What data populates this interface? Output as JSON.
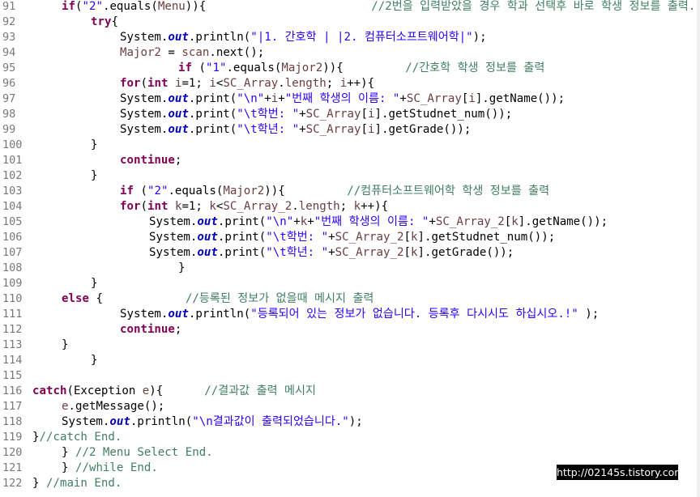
{
  "colors": {
    "background": "#ffffff",
    "line_number": "#787878",
    "keyword": "#7f0055",
    "string": "#2a00ff",
    "static_field": "#0000c0",
    "local_variable": "#6a3e3e",
    "comment": "#3f7f5f",
    "default_text": "#000000"
  },
  "lines": [
    {
      "n": "91",
      "indent": 1,
      "tokens": [
        [
          "kw",
          "if"
        ],
        [
          "t",
          "("
        ],
        [
          "str",
          "\"2\""
        ],
        [
          "t",
          ".equals("
        ],
        [
          "var",
          "Menu"
        ],
        [
          "t",
          "))"
        ],
        [
          "t",
          "{"
        ],
        [
          "sp",
          24
        ],
        [
          "cmt",
          "//2번을 입력받았을 경우 학과 선택후 바로 학생 정보를 출력."
        ]
      ]
    },
    {
      "n": "92",
      "indent": 2,
      "tokens": [
        [
          "kw",
          "try"
        ],
        [
          "t",
          "{"
        ]
      ]
    },
    {
      "n": "93",
      "indent": 3,
      "tokens": [
        [
          "t",
          "System."
        ],
        [
          "fld",
          "out"
        ],
        [
          "t",
          ".println("
        ],
        [
          "str",
          "\"|1. 간호학 | |2. 컴퓨터소프트웨어학|\""
        ],
        [
          "t",
          ");"
        ]
      ]
    },
    {
      "n": "94",
      "indent": 3,
      "tokens": [
        [
          "var",
          "Major2"
        ],
        [
          "t",
          " = "
        ],
        [
          "var",
          "scan"
        ],
        [
          "t",
          ".next();"
        ]
      ]
    },
    {
      "n": "95",
      "indent": 5,
      "tokens": [
        [
          "kw",
          "if"
        ],
        [
          "t",
          " ("
        ],
        [
          "str",
          "\"1\""
        ],
        [
          "t",
          ".equals("
        ],
        [
          "var",
          "Major2"
        ],
        [
          "t",
          "))"
        ],
        [
          "t",
          "{"
        ],
        [
          "sp",
          9
        ],
        [
          "cmt",
          "//간호학 학생 정보를 출력"
        ]
      ]
    },
    {
      "n": "96",
      "indent": 3,
      "tokens": [
        [
          "kw",
          "for"
        ],
        [
          "t",
          "("
        ],
        [
          "kw",
          "int"
        ],
        [
          "t",
          " "
        ],
        [
          "var",
          "i"
        ],
        [
          "t",
          "=1; "
        ],
        [
          "var",
          "i"
        ],
        [
          "t",
          "<"
        ],
        [
          "var",
          "SC_Array"
        ],
        [
          "t",
          "."
        ],
        [
          "var",
          "length"
        ],
        [
          "t",
          "; "
        ],
        [
          "var",
          "i"
        ],
        [
          "t",
          "++){"
        ]
      ]
    },
    {
      "n": "97",
      "indent": 3,
      "tokens": [
        [
          "t",
          "System."
        ],
        [
          "fld",
          "out"
        ],
        [
          "t",
          ".print("
        ],
        [
          "str",
          "\"\\n\""
        ],
        [
          "t",
          "+"
        ],
        [
          "var",
          "i"
        ],
        [
          "t",
          "+"
        ],
        [
          "str",
          "\"번째 학생의 이름: \""
        ],
        [
          "t",
          "+"
        ],
        [
          "var",
          "SC_Array"
        ],
        [
          "t",
          "["
        ],
        [
          "var",
          "i"
        ],
        [
          "t",
          "].getName());"
        ]
      ]
    },
    {
      "n": "98",
      "indent": 3,
      "tokens": [
        [
          "t",
          "System."
        ],
        [
          "fld",
          "out"
        ],
        [
          "t",
          ".print("
        ],
        [
          "str",
          "\"\\t학번: \""
        ],
        [
          "t",
          "+"
        ],
        [
          "var",
          "SC_Array"
        ],
        [
          "t",
          "["
        ],
        [
          "var",
          "i"
        ],
        [
          "t",
          "].getStudnet_num());"
        ]
      ]
    },
    {
      "n": "99",
      "indent": 3,
      "tokens": [
        [
          "t",
          "System."
        ],
        [
          "fld",
          "out"
        ],
        [
          "t",
          ".print("
        ],
        [
          "str",
          "\"\\t학년: \""
        ],
        [
          "t",
          "+"
        ],
        [
          "var",
          "SC_Array"
        ],
        [
          "t",
          "["
        ],
        [
          "var",
          "i"
        ],
        [
          "t",
          "].getGrade());"
        ]
      ]
    },
    {
      "n": "100",
      "indent": 2,
      "tokens": [
        [
          "t",
          "}"
        ]
      ]
    },
    {
      "n": "101",
      "indent": 3,
      "tokens": [
        [
          "kw",
          "continue"
        ],
        [
          "t",
          ";"
        ]
      ]
    },
    {
      "n": "102",
      "indent": 2,
      "tokens": [
        [
          "t",
          "}"
        ]
      ]
    },
    {
      "n": "103",
      "indent": 3,
      "tokens": [
        [
          "kw",
          "if"
        ],
        [
          "t",
          " ("
        ],
        [
          "str",
          "\"2\""
        ],
        [
          "t",
          ".equals("
        ],
        [
          "var",
          "Major2"
        ],
        [
          "t",
          "))"
        ],
        [
          "t",
          "{"
        ],
        [
          "sp",
          9
        ],
        [
          "cmt",
          "//컴퓨터소프트웨어학 학생 정보를 출력"
        ]
      ]
    },
    {
      "n": "104",
      "indent": 3,
      "tokens": [
        [
          "kw",
          "for"
        ],
        [
          "t",
          "("
        ],
        [
          "kw",
          "int"
        ],
        [
          "t",
          " "
        ],
        [
          "var",
          "k"
        ],
        [
          "t",
          "=1; "
        ],
        [
          "var",
          "k"
        ],
        [
          "t",
          "<"
        ],
        [
          "var",
          "SC_Array_2"
        ],
        [
          "t",
          "."
        ],
        [
          "var",
          "length"
        ],
        [
          "t",
          "; "
        ],
        [
          "var",
          "k"
        ],
        [
          "t",
          "++){"
        ]
      ]
    },
    {
      "n": "105",
      "indent": 4,
      "tokens": [
        [
          "t",
          "System."
        ],
        [
          "fld",
          "out"
        ],
        [
          "t",
          ".print("
        ],
        [
          "str",
          "\"\\n\""
        ],
        [
          "t",
          "+"
        ],
        [
          "var",
          "k"
        ],
        [
          "t",
          "+"
        ],
        [
          "str",
          "\"번째 학생의 이름: \""
        ],
        [
          "t",
          "+"
        ],
        [
          "var",
          "SC_Array_2"
        ],
        [
          "t",
          "["
        ],
        [
          "var",
          "k"
        ],
        [
          "t",
          "].getName());"
        ]
      ]
    },
    {
      "n": "106",
      "indent": 4,
      "tokens": [
        [
          "t",
          "System."
        ],
        [
          "fld",
          "out"
        ],
        [
          "t",
          ".print("
        ],
        [
          "str",
          "\"\\t학번: \""
        ],
        [
          "t",
          "+"
        ],
        [
          "var",
          "SC_Array_2"
        ],
        [
          "t",
          "["
        ],
        [
          "var",
          "k"
        ],
        [
          "t",
          "].getStudnet_num());"
        ]
      ]
    },
    {
      "n": "107",
      "indent": 4,
      "tokens": [
        [
          "t",
          "System."
        ],
        [
          "fld",
          "out"
        ],
        [
          "t",
          ".print("
        ],
        [
          "str",
          "\"\\t학년: \""
        ],
        [
          "t",
          "+"
        ],
        [
          "var",
          "SC_Array_2"
        ],
        [
          "t",
          "["
        ],
        [
          "var",
          "k"
        ],
        [
          "t",
          "].getGrade());"
        ]
      ]
    },
    {
      "n": "108",
      "indent": 5,
      "tokens": [
        [
          "t",
          "}"
        ]
      ]
    },
    {
      "n": "109",
      "indent": 2,
      "tokens": [
        [
          "t",
          "}"
        ]
      ]
    },
    {
      "n": "110",
      "indent": 1,
      "tokens": [
        [
          "kw",
          "else"
        ],
        [
          "t",
          " {"
        ],
        [
          "sp",
          12
        ],
        [
          "cmt",
          "//등록된 정보가 없을때 메시지 출력"
        ]
      ]
    },
    {
      "n": "111",
      "indent": 3,
      "tokens": [
        [
          "t",
          "System."
        ],
        [
          "fld",
          "out"
        ],
        [
          "t",
          ".println("
        ],
        [
          "str",
          "\"등록되어 있는 정보가 없습니다. 등록후 다시시도 하십시오.!\""
        ],
        [
          "t",
          " );"
        ]
      ]
    },
    {
      "n": "112",
      "indent": 3,
      "tokens": [
        [
          "kw",
          "continue"
        ],
        [
          "t",
          ";"
        ]
      ]
    },
    {
      "n": "113",
      "indent": 1,
      "tokens": [
        [
          "t",
          "}"
        ]
      ]
    },
    {
      "n": "114",
      "indent": 2,
      "tokens": [
        [
          "t",
          "}"
        ]
      ]
    },
    {
      "n": "115",
      "indent": 0,
      "tokens": []
    },
    {
      "n": "116",
      "indent": 0,
      "tokens": [
        [
          "kw",
          "catch"
        ],
        [
          "t",
          "("
        ],
        [
          "t",
          "Exception "
        ],
        [
          "var",
          "e"
        ],
        [
          "t",
          "){"
        ],
        [
          "sp",
          6
        ],
        [
          "cmt",
          "//결과값 출력 메시지"
        ]
      ]
    },
    {
      "n": "117",
      "indent": 1,
      "tokens": [
        [
          "var",
          "e"
        ],
        [
          "t",
          ".getMessage();"
        ]
      ]
    },
    {
      "n": "118",
      "indent": 1,
      "tokens": [
        [
          "t",
          "System."
        ],
        [
          "fld",
          "out"
        ],
        [
          "t",
          ".println("
        ],
        [
          "str",
          "\"\\n결과값이 출력되었습니다.\""
        ],
        [
          "t",
          ");"
        ]
      ]
    },
    {
      "n": "119",
      "indent": 0,
      "tokens": [
        [
          "t",
          "}"
        ],
        [
          "cmt",
          "//catch End."
        ]
      ]
    },
    {
      "n": "120",
      "indent": 1,
      "tokens": [
        [
          "t",
          "} "
        ],
        [
          "cmt",
          "//2 Menu Select End."
        ]
      ]
    },
    {
      "n": "121",
      "indent": 1,
      "tokens": [
        [
          "t",
          "} "
        ],
        [
          "cmt",
          "//while End."
        ]
      ]
    },
    {
      "n": "122",
      "indent": 0,
      "tokens": [
        [
          "t",
          "} "
        ],
        [
          "cmt",
          "//main End."
        ]
      ]
    }
  ],
  "watermark": "http://02145s.tistory.com"
}
